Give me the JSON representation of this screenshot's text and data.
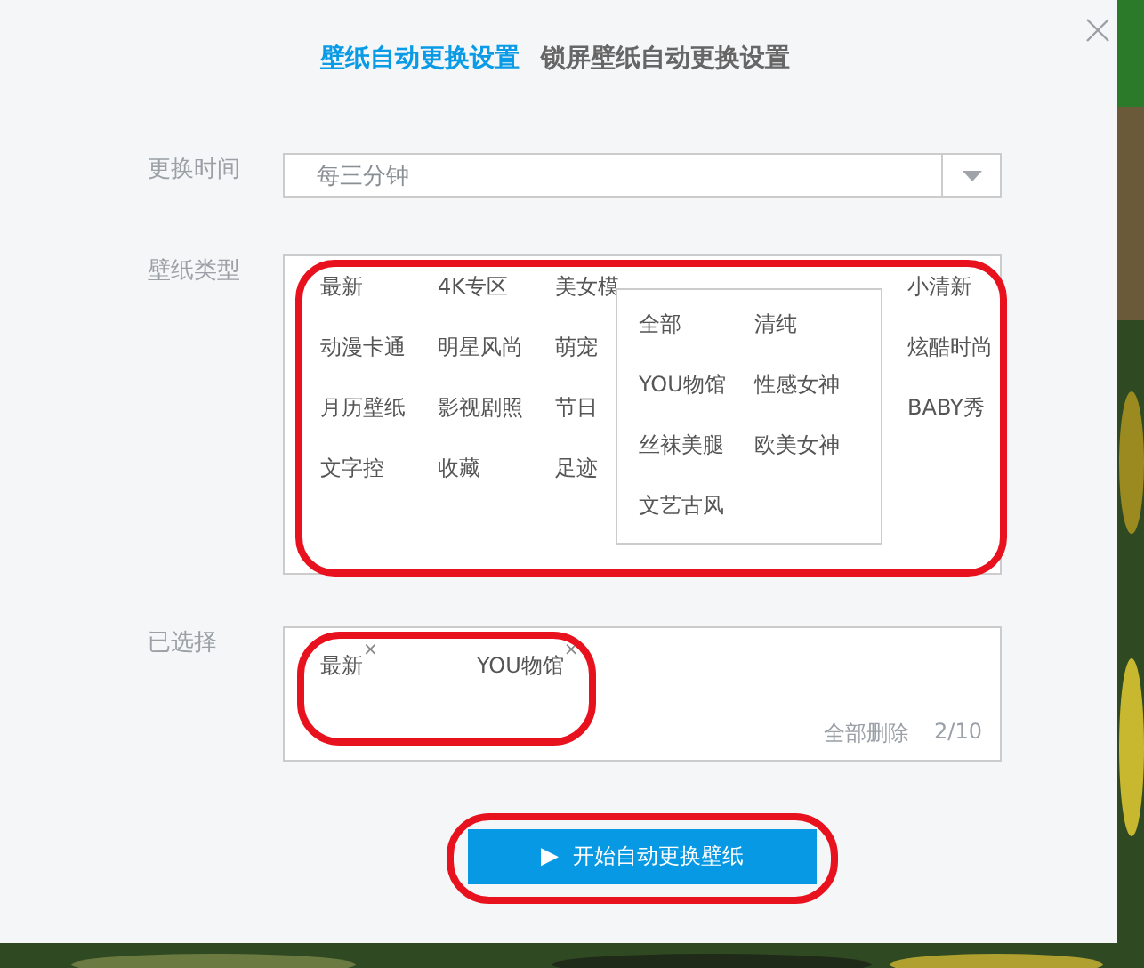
{
  "tabs": [
    {
      "label": "壁纸自动更换设置",
      "selected": true
    },
    {
      "label": "锁屏壁纸自动更换设置",
      "selected": false
    }
  ],
  "interval": {
    "label": "更换时间",
    "value": "每三分钟"
  },
  "types": {
    "label": "壁纸类型",
    "items": [
      [
        {
          "label": "最新"
        },
        {
          "label": "4K专区"
        },
        {
          "label": "美女模"
        },
        {
          "label": "小清新"
        }
      ],
      [
        {
          "label": "动漫卡通"
        },
        {
          "label": "明星风尚"
        },
        {
          "label": "萌宠"
        },
        {
          "label": "炫酷时尚"
        }
      ],
      [
        {
          "label": "月历壁纸"
        },
        {
          "label": "影视剧照"
        },
        {
          "label": "节日"
        },
        {
          "label": "BABY秀"
        }
      ],
      [
        {
          "label": "文字控"
        },
        {
          "label": "收藏"
        },
        {
          "label": "足迹"
        }
      ]
    ],
    "more": [
      "全部",
      "清纯",
      "YOU物馆",
      "性感女神",
      "丝袜美腿",
      "欧美女神",
      "文艺古风"
    ]
  },
  "selected": {
    "label": "已选择",
    "tags": [
      {
        "label": "最新",
        "remove": "×"
      },
      {
        "label": "YOU物馆",
        "remove": "×"
      }
    ],
    "clear": "全部删除",
    "count": "2/10"
  },
  "start_button": {
    "icon": "▶",
    "label": "开始自动更换壁纸"
  }
}
